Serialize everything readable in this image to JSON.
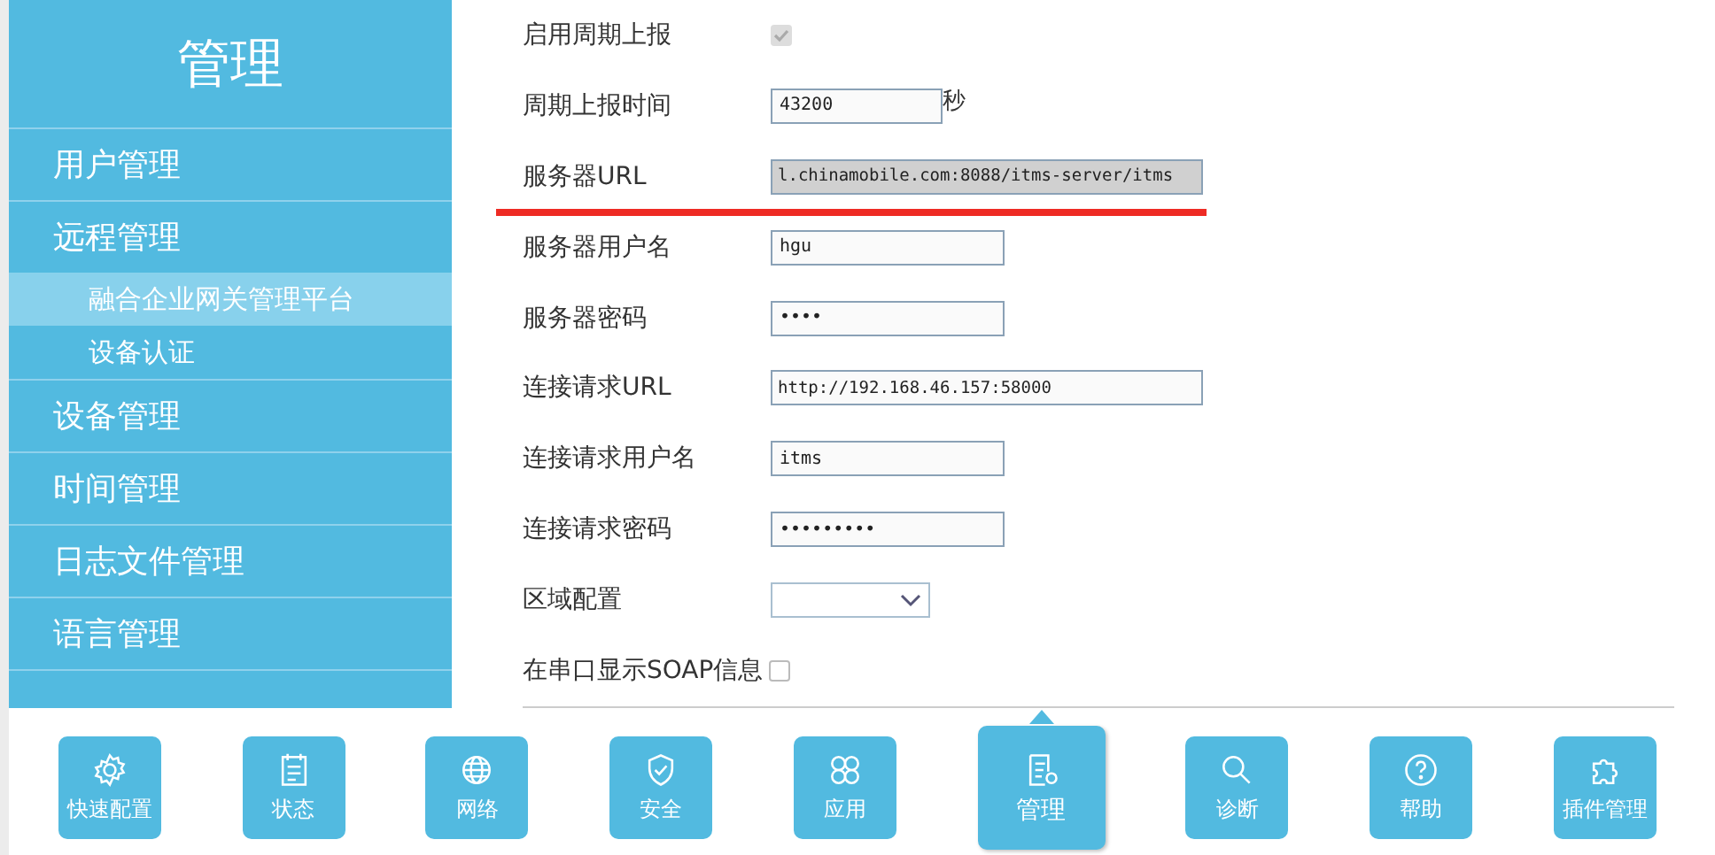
{
  "sidebar": {
    "title": "管理",
    "items": [
      {
        "label": "用户管理",
        "selected": false
      },
      {
        "label": "远程管理",
        "selected": false,
        "children": [
          {
            "label": "融合企业网关管理平台",
            "selected": true
          },
          {
            "label": "设备认证",
            "selected": false
          }
        ]
      },
      {
        "label": "设备管理",
        "selected": false
      },
      {
        "label": "时间管理",
        "selected": false
      },
      {
        "label": "日志文件管理",
        "selected": false
      },
      {
        "label": "语言管理",
        "selected": false
      }
    ]
  },
  "form": [
    {
      "kind": "checkbox",
      "label": "启用周期上报",
      "checked": true,
      "disabled": true
    },
    {
      "kind": "number",
      "label": "周期上报时间",
      "value": "43200",
      "unit": "秒"
    },
    {
      "kind": "url",
      "label": "服务器URL",
      "value": "l.chinamobile.com:8088/itms-server/itms",
      "highlighted": true
    },
    {
      "kind": "text",
      "label": "服务器用户名",
      "value": "hgu"
    },
    {
      "kind": "text",
      "label": "服务器密码",
      "value": "••••"
    },
    {
      "kind": "url",
      "label": "连接请求URL",
      "value": "http://192.168.46.157:58000"
    },
    {
      "kind": "text",
      "label": "连接请求用户名",
      "value": "itms"
    },
    {
      "kind": "text",
      "label": "连接请求密码",
      "value": "•••••••••"
    },
    {
      "kind": "select",
      "label": "区域配置"
    },
    {
      "kind": "checkbox",
      "label": "在串口显示SOAP信息",
      "checked": false,
      "disabled": false
    }
  ],
  "nav": [
    {
      "label": "快速配置",
      "selected": false
    },
    {
      "label": "状态",
      "selected": false
    },
    {
      "label": "网络",
      "selected": false
    },
    {
      "label": "安全",
      "selected": false
    },
    {
      "label": "应用",
      "selected": false
    },
    {
      "label": "管理",
      "selected": true
    },
    {
      "label": "诊断",
      "selected": false
    },
    {
      "label": "帮助",
      "selected": false
    },
    {
      "label": "插件管理",
      "selected": false
    }
  ]
}
